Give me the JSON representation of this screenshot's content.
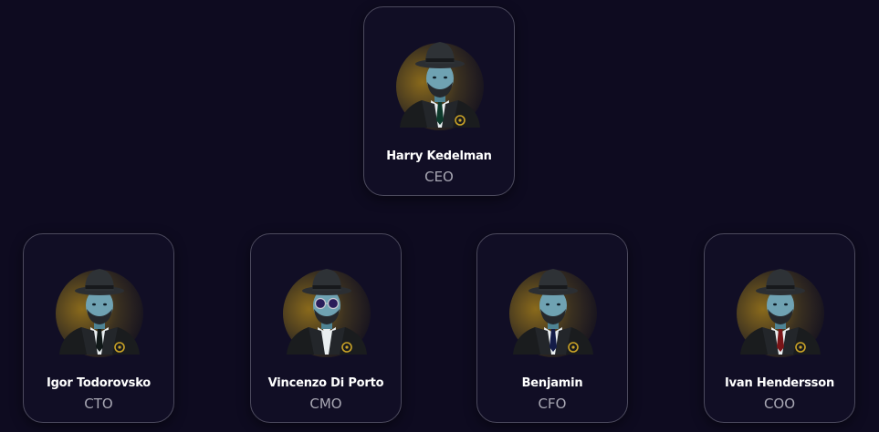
{
  "colors": {
    "background": "#0e0b20",
    "card_border": "#4c4a5e",
    "name": "#ffffff",
    "role": "#a9a8b4",
    "accent_gold": "#c9a227"
  },
  "team": [
    {
      "name": "Harry Kedelman",
      "role": "CEO",
      "tie": "#0e3a2c",
      "eyewear": "none",
      "icon": "detective-avatar"
    },
    {
      "name": "Igor Todorovsko",
      "role": "CTO",
      "tie": "#101818",
      "eyewear": "none",
      "icon": "detective-avatar"
    },
    {
      "name": "Vincenzo Di Porto",
      "role": "CMO",
      "tie": "none",
      "eyewear": "sunglasses",
      "icon": "detective-avatar"
    },
    {
      "name": "Benjamin",
      "role": "CFO",
      "tie": "#141c48",
      "eyewear": "none",
      "icon": "detective-avatar"
    },
    {
      "name": "Ivan Hendersson",
      "role": "COO",
      "tie": "#7a1518",
      "eyewear": "none",
      "icon": "detective-avatar"
    }
  ]
}
